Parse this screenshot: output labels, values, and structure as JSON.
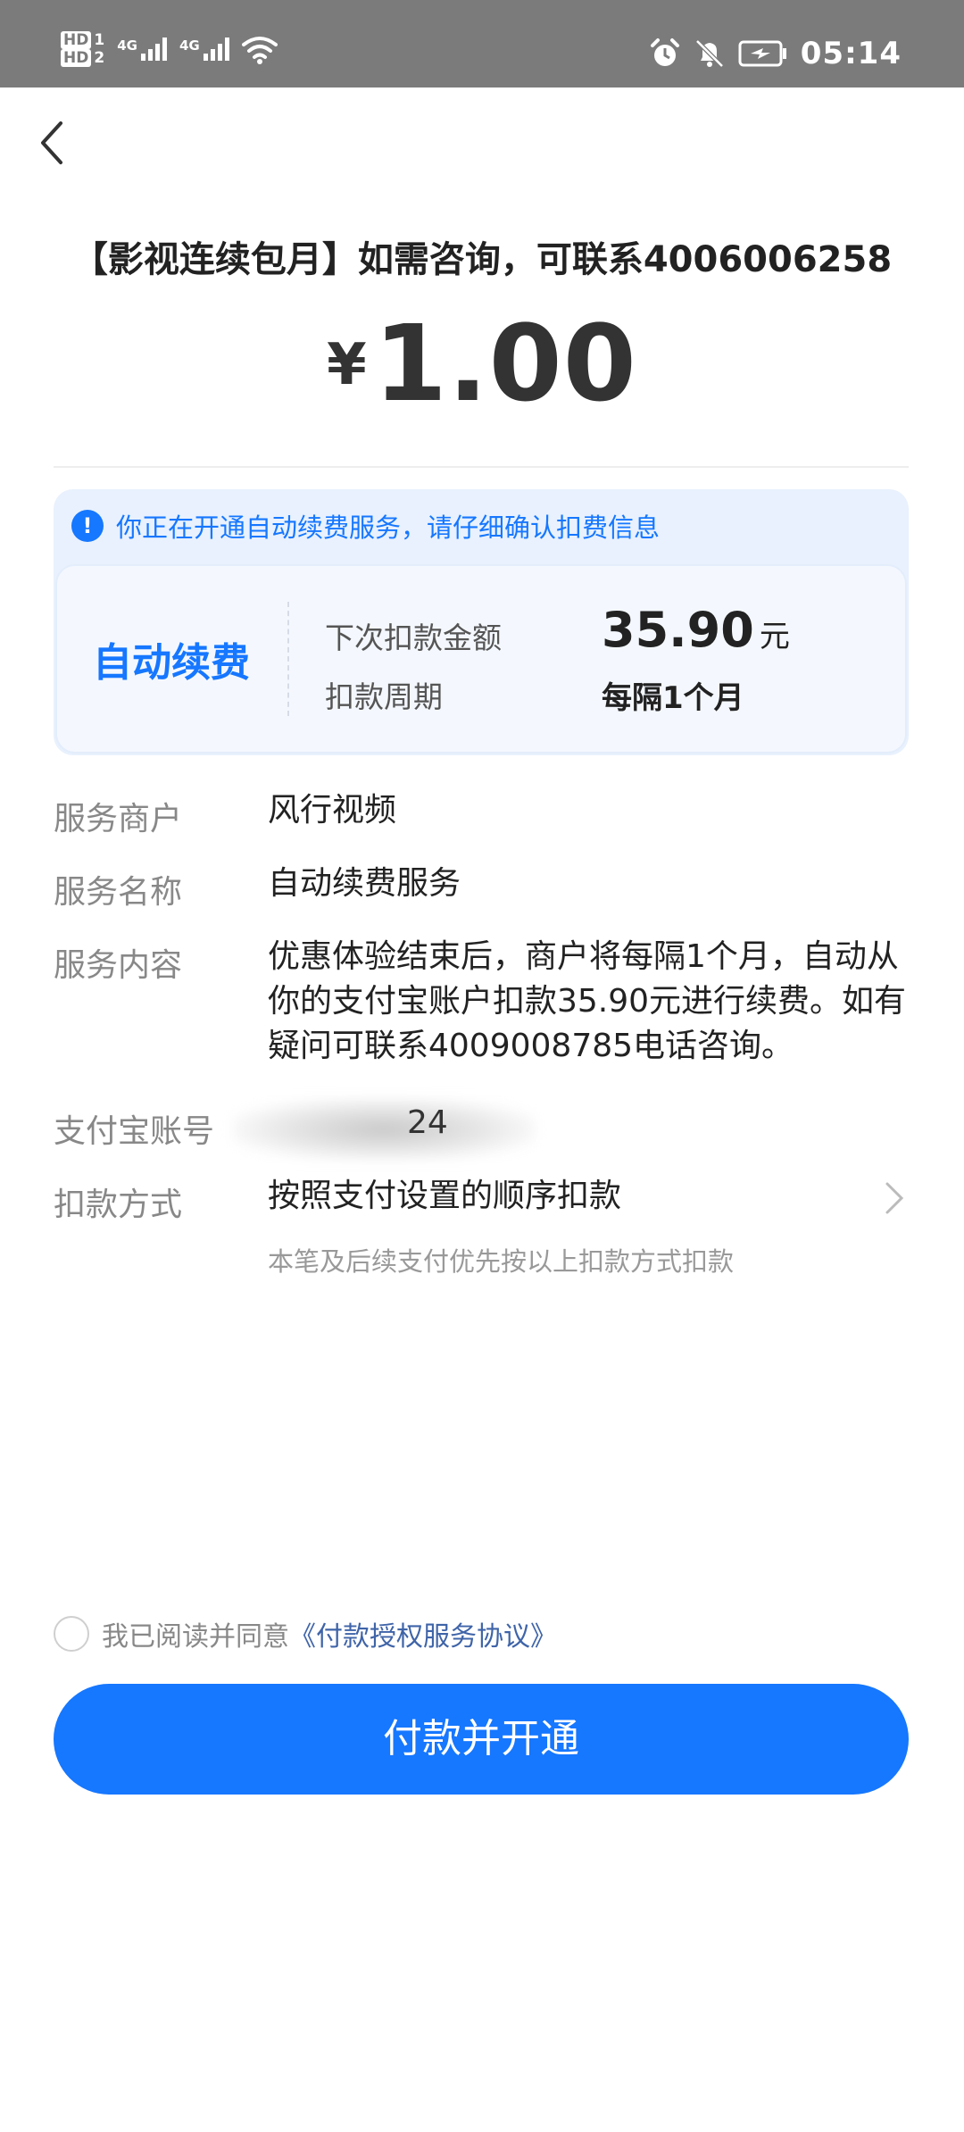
{
  "status_bar": {
    "hd1": "HD",
    "hd1_index": "1",
    "hd2": "HD",
    "hd2_index": "2",
    "net1": "4G",
    "net2": "4G",
    "time": "05:14"
  },
  "header": {
    "title": "【影视连续包月】如需咨询，可联系4006006258",
    "currency": "¥",
    "amount": "1.00"
  },
  "notice": {
    "text": "你正在开通自动续费服务，请仔细确认扣费信息",
    "auto_label": "自动续费",
    "next_amount_label": "下次扣款金额",
    "next_amount_value": "35.90",
    "next_amount_unit": "元",
    "cycle_label": "扣款周期",
    "cycle_value": "每隔1个月"
  },
  "details": {
    "merchant_label": "服务商户",
    "merchant_value": "风行视频",
    "service_name_label": "服务名称",
    "service_name_value": "自动续费服务",
    "content_label": "服务内容",
    "content_value": "优惠体验结束后，商户将每隔1个月，自动从你的支付宝账户扣款35.90元进行续费。如有疑问可联系4009008785电话咨询。",
    "account_label": "支付宝账号",
    "account_value": "24",
    "method_label": "扣款方式",
    "method_value": "按照支付设置的顺序扣款",
    "method_hint": "本笔及后续支付优先按以上扣款方式扣款"
  },
  "agreement": {
    "prefix": "我已阅读并同意",
    "link": "《付款授权服务协议》"
  },
  "pay_button": {
    "label": "付款并开通"
  },
  "colors": {
    "accent": "#1677ff",
    "status_bar": "#7b7b7b",
    "notice_bg": "#e8f1fd"
  },
  "icons": [
    "alarm-icon",
    "bell-off-icon",
    "battery-charging-icon",
    "wifi-icon",
    "signal-icon",
    "back-arrow-icon",
    "info-icon",
    "chevron-right-icon"
  ]
}
